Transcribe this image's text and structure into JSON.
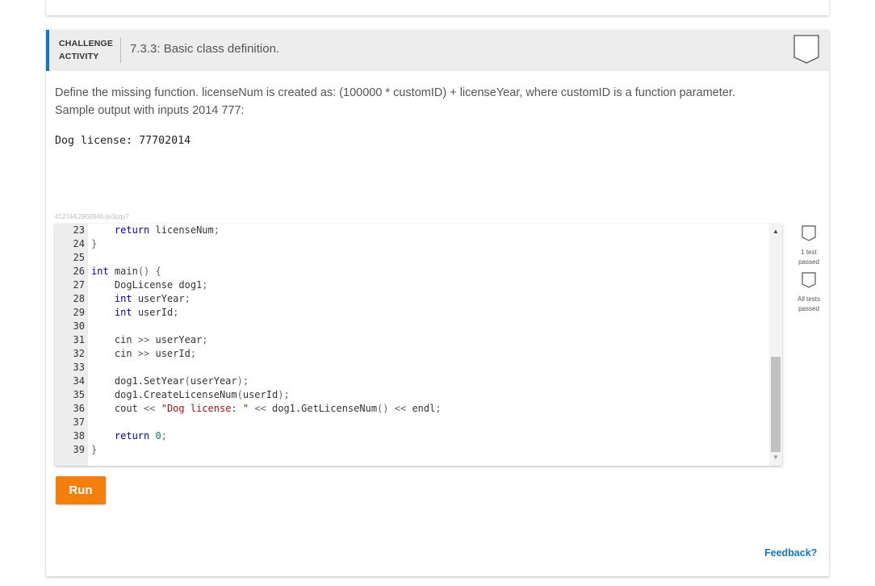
{
  "header": {
    "label_line1": "CHALLENGE",
    "label_line2": "ACTIVITY",
    "title": "7.3.3: Basic class definition."
  },
  "instructions": "Define the missing function. licenseNum is created as: (100000 * customID) + licenseYear, where customID is a function parameter. Sample output with inputs 2014 777:",
  "sample_output": "Dog license: 77702014",
  "hash_id": "412744.2902946.qx3zqy7",
  "code_lines": [
    {
      "num": "23",
      "text": "    return licenseNum;"
    },
    {
      "num": "24",
      "text": "}"
    },
    {
      "num": "25",
      "text": ""
    },
    {
      "num": "26",
      "text": "int main() {"
    },
    {
      "num": "27",
      "text": "    DogLicense dog1;"
    },
    {
      "num": "28",
      "text": "    int userYear;"
    },
    {
      "num": "29",
      "text": "    int userId;"
    },
    {
      "num": "30",
      "text": ""
    },
    {
      "num": "31",
      "text": "    cin >> userYear;"
    },
    {
      "num": "32",
      "text": "    cin >> userId;"
    },
    {
      "num": "33",
      "text": ""
    },
    {
      "num": "34",
      "text": "    dog1.SetYear(userYear);"
    },
    {
      "num": "35",
      "text": "    dog1.CreateLicenseNum(userId);"
    },
    {
      "num": "36",
      "text": "    cout << \"Dog license: \" << dog1.GetLicenseNum() << endl;"
    },
    {
      "num": "37",
      "text": ""
    },
    {
      "num": "38",
      "text": "    return 0;"
    },
    {
      "num": "39",
      "text": "}"
    }
  ],
  "tests": [
    {
      "label_line1": "1 test",
      "label_line2": "passed"
    },
    {
      "label_line1": "All tests",
      "label_line2": "passed"
    }
  ],
  "run_label": "Run",
  "feedback_label": "Feedback?",
  "colors": {
    "accent": "#1477c3",
    "run_button": "#f57f0c"
  }
}
